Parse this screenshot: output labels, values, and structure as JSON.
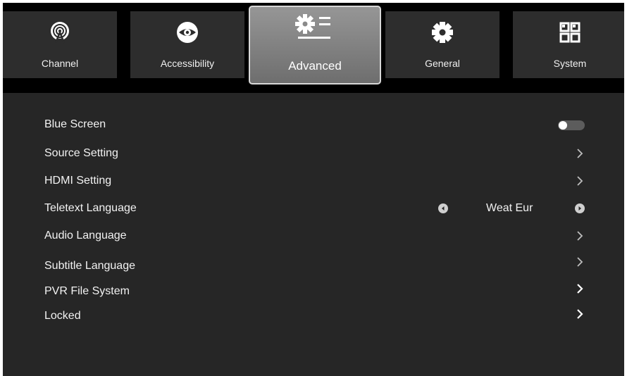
{
  "tabs": [
    {
      "label": "Channel",
      "icon": "antenna-icon"
    },
    {
      "label": "Accessibility",
      "icon": "eye-icon"
    },
    {
      "label": "Advanced",
      "icon": "gear-list-icon",
      "active": true
    },
    {
      "label": "General",
      "icon": "gear-icon"
    },
    {
      "label": "System",
      "icon": "windows-icon"
    }
  ],
  "settings": [
    {
      "label": "Blue Screen",
      "control": "toggle",
      "toggle_on": false
    },
    {
      "label": "Source Setting",
      "control": "chevron"
    },
    {
      "label": "HDMI Setting",
      "control": "chevron"
    },
    {
      "label": "Teletext Language",
      "control": "selector",
      "value": "Weat Eur"
    },
    {
      "label": "Audio Language",
      "control": "chevron"
    },
    {
      "label": "Subtitle Language",
      "control": "chevron"
    },
    {
      "label": "PVR File System",
      "control": "chevron"
    },
    {
      "label": "Locked",
      "control": "chevron"
    }
  ],
  "colors": {
    "background": "#262626",
    "tab_bar": "#000000",
    "tab": "#2d2d2d",
    "tab_active": "#8a8a8a",
    "text": "#f2f2f2"
  }
}
